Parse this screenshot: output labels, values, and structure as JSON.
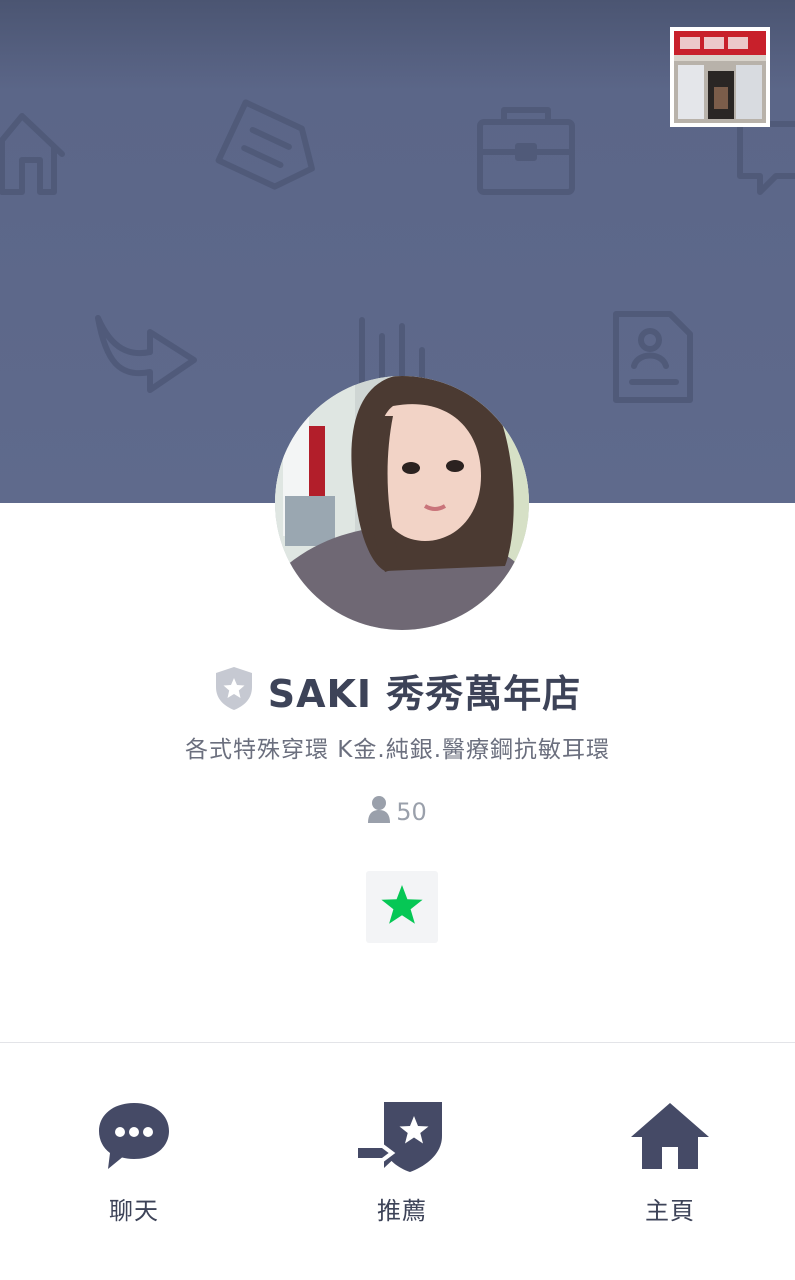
{
  "profile": {
    "name": "SAKI 秀秀萬年店",
    "status_message": "各式特殊穿環 K金.純銀.醫療鋼抗敏耳環",
    "friend_count": "50",
    "badge_icon": "shield-star-icon",
    "favorite_icon": "star-icon",
    "favorite_color": "#06c755"
  },
  "cover": {
    "thumbnail_icon": "store-front-thumbnail",
    "background_color": "#5f6a8c"
  },
  "actions": [
    {
      "label": "聊天",
      "icon": "chat-bubble-icon"
    },
    {
      "label": "推薦",
      "icon": "recommend-icon"
    },
    {
      "label": "主頁",
      "icon": "home-icon"
    }
  ],
  "colors": {
    "accent_dark": "#454a66",
    "title_text": "#3d4358"
  }
}
